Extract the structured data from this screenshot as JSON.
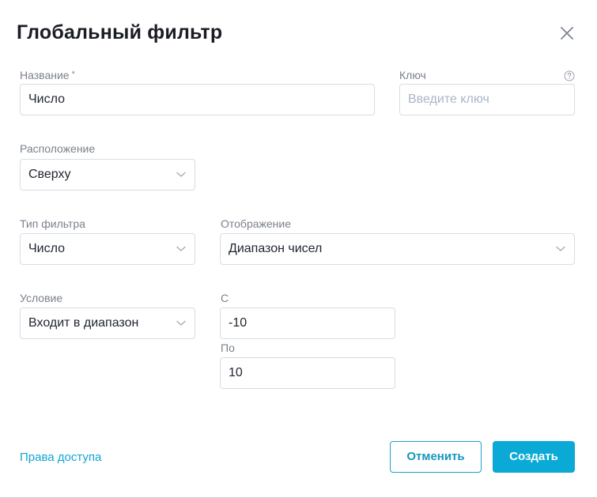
{
  "dialog": {
    "title": "Глобальный фильтр",
    "close_icon": "close-icon"
  },
  "form": {
    "name": {
      "label": "Название",
      "required_mark": "*",
      "value": "Число"
    },
    "key": {
      "label": "Ключ",
      "placeholder": "Введите ключ",
      "value": "",
      "help_icon": "question-circle-icon"
    },
    "position": {
      "label": "Расположение",
      "selected": "Сверху"
    },
    "filter_type": {
      "label": "Тип фильтра",
      "selected": "Число"
    },
    "display": {
      "label": "Отображение",
      "selected": "Диапазон чисел"
    },
    "condition": {
      "label": "Условие",
      "selected": "Входит в диапазон"
    },
    "from": {
      "label": "С",
      "value": "-10"
    },
    "to": {
      "label": "По",
      "value": "10"
    }
  },
  "footer": {
    "access_link": "Права доступа",
    "cancel_label": "Отменить",
    "create_label": "Создать"
  },
  "colors": {
    "accent": "#0ba9d5",
    "link": "#12a6d4",
    "border": "#d9dce1",
    "label": "#7a808c"
  }
}
